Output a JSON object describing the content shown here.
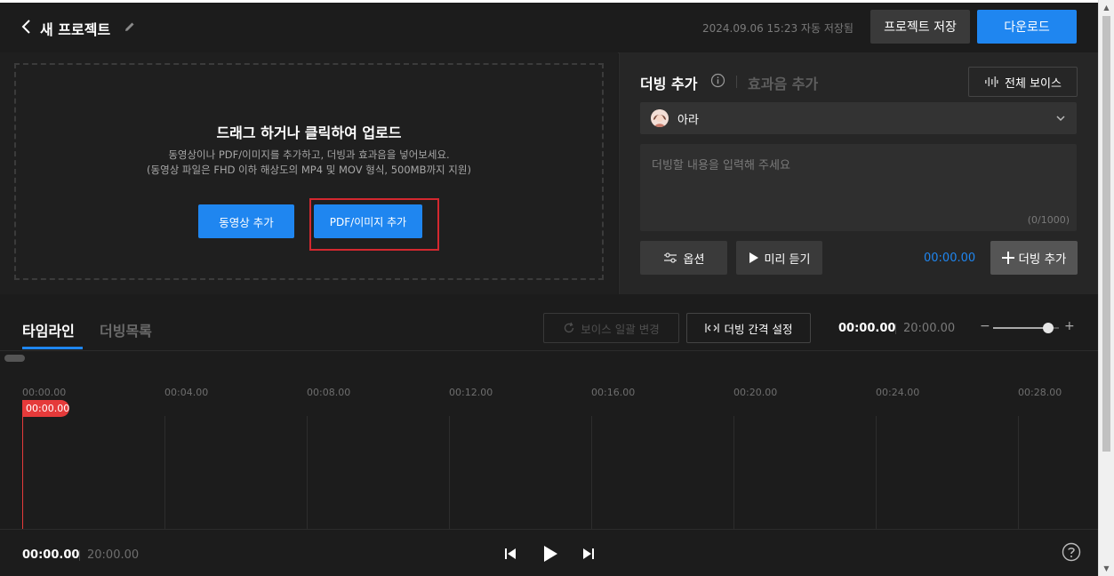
{
  "header": {
    "project_title": "새 프로젝트",
    "autosave_text": "2024.09.06 15:23 자동 저장됨",
    "save_label": "프로젝트 저장",
    "download_label": "다운로드"
  },
  "upload": {
    "title": "드래그 하거나 클릭하여 업로드",
    "desc_line1": "동영상이나 PDF/이미지를 추가하고, 더빙과 효과음을 넣어보세요.",
    "desc_line2": "(동영상 파일은 FHD 이하 해상도의 MP4 및 MOV 형식, 500MB까지 지원)",
    "video_button": "동영상 추가",
    "pdf_button": "PDF/이미지 추가"
  },
  "dub_panel": {
    "tab_dub": "더빙 추가",
    "tab_sfx": "효과음 추가",
    "all_voice_label": "전체 보이스",
    "voice_name": "아라",
    "text_placeholder": "더빙할 내용을 입력해 주세요",
    "char_count": "(0/1000)",
    "option_label": "옵션",
    "preview_label": "미리 듣기",
    "time_value": "00:00.00",
    "add_dub_label": "더빙 추가"
  },
  "timeline": {
    "tab_timeline": "타임라인",
    "tab_dub_list": "더빙목록",
    "voice_batch_label": "보이스 일괄 변경",
    "gap_setting_label": "더빙 간격 설정",
    "current_time": "00:00.00",
    "total_time": "20:00.00",
    "zoom_level": 0.8,
    "ruler": [
      "00:00.00",
      "00:04.00",
      "00:08.00",
      "00:12.00",
      "00:16.00",
      "00:20.00",
      "00:24.00",
      "00:28.00"
    ],
    "playhead_label": "00:00.00"
  },
  "footer": {
    "current_time": "00:00.00",
    "total_time": "20:00.00"
  },
  "colors": {
    "accent": "#1f86f0",
    "playhead": "#e53a3a",
    "highlight": "#d4282f"
  }
}
